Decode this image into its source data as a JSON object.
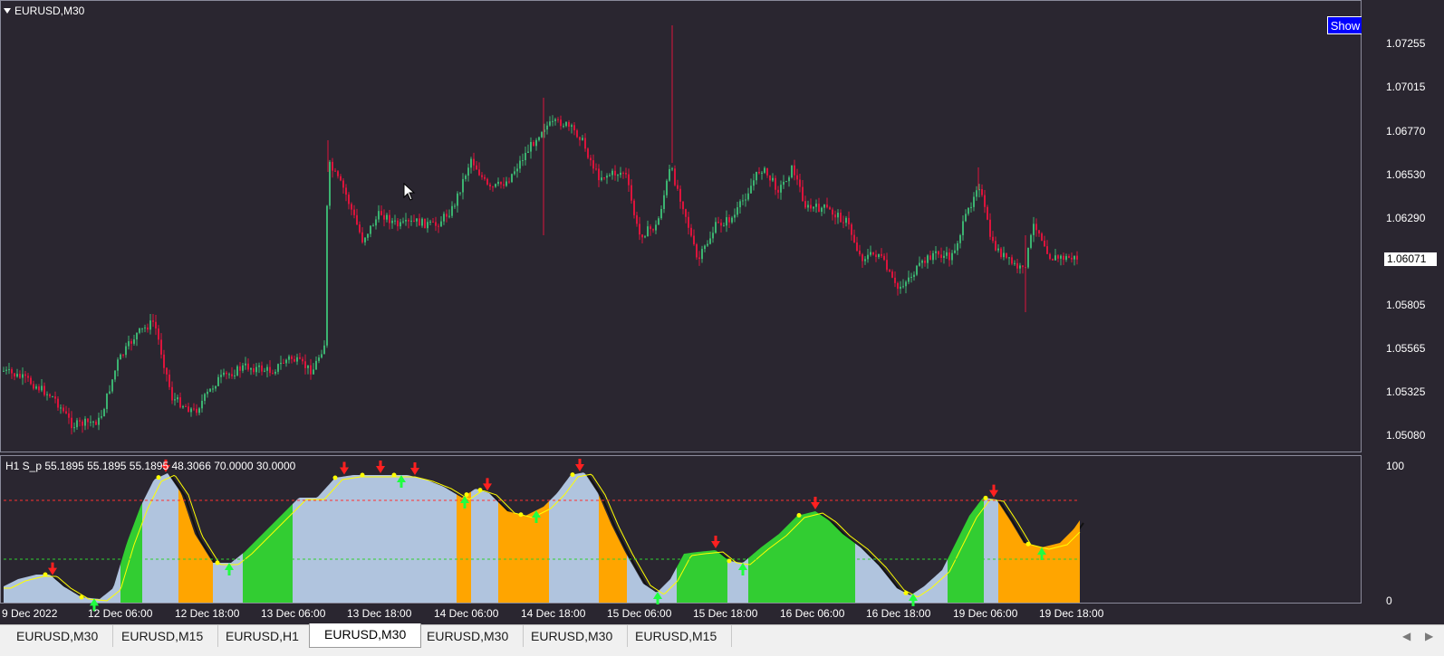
{
  "window": {
    "symbol_label": "EURUSD,M30",
    "show_button": "Show"
  },
  "price_axis": {
    "ticks": [
      "1.07255",
      "1.07015",
      "1.06770",
      "1.06530",
      "1.06290",
      "1.05805",
      "1.05565",
      "1.05325",
      "1.05080"
    ],
    "current_price": "1.06071"
  },
  "indicator": {
    "label": "H1 S_p 55.1895 55.1895 55.1895 48.3066 70.0000 30.0000",
    "scale_top": "100",
    "scale_bottom": "0"
  },
  "time_axis": {
    "ticks": [
      "9 Dec 2022",
      "12 Dec 06:00",
      "12 Dec 18:00",
      "13 Dec 06:00",
      "13 Dec 18:00",
      "14 Dec 06:00",
      "14 Dec 18:00",
      "15 Dec 06:00",
      "15 Dec 18:00",
      "16 Dec 06:00",
      "16 Dec 18:00",
      "19 Dec 06:00",
      "19 Dec 18:00"
    ]
  },
  "tabs": [
    {
      "label": "EURUSD,M30",
      "active": false
    },
    {
      "label": "EURUSD,M15",
      "active": false
    },
    {
      "label": "EURUSD,H1",
      "active": false
    },
    {
      "label": "EURUSD,M30",
      "active": true
    },
    {
      "label": "EURUSD,M30",
      "active": false
    },
    {
      "label": "EURUSD,M30",
      "active": false
    },
    {
      "label": "EURUSD,M15",
      "active": false
    }
  ],
  "colors": {
    "background": "#2a2630",
    "bull_candle": "#3cb371",
    "bear_candle": "#dc143c",
    "osc_fill": "#b0c4de",
    "osc_green": "#32cd32",
    "osc_orange": "#ffa500",
    "signal_line": "#ffff00",
    "level_upper": "#ff3030",
    "level_lower": "#30d030",
    "show_button": "#0000ff"
  },
  "icons": {
    "symbol_menu": "triangle-down-icon",
    "cursor": "arrow-cursor-icon",
    "tab_left": "chevron-left-icon",
    "tab_right": "chevron-right-icon"
  }
}
